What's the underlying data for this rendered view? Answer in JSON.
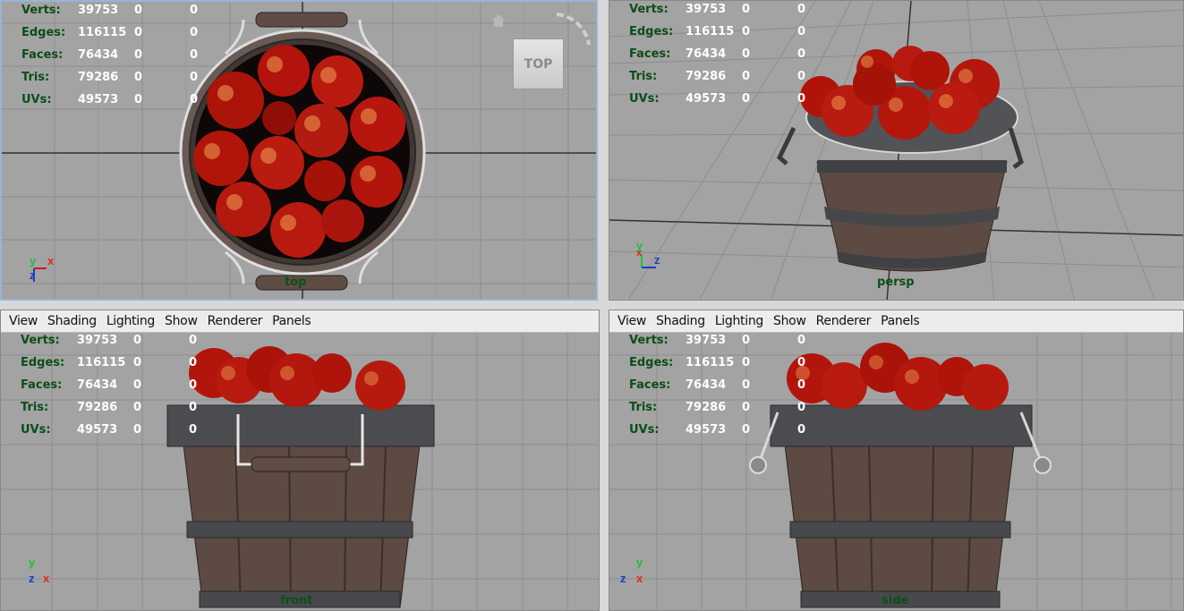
{
  "hud_labels": [
    "Verts:",
    "Edges:",
    "Faces:",
    "Tris:",
    "UVs:"
  ],
  "hud_values": [
    [
      "39753",
      "0",
      "0"
    ],
    [
      "116115",
      "0",
      "0"
    ],
    [
      "76434",
      "0",
      "0"
    ],
    [
      "79286",
      "0",
      "0"
    ],
    [
      "49573",
      "0",
      "0"
    ]
  ],
  "menu": [
    "View",
    "Shading",
    "Lighting",
    "Show",
    "Renderer",
    "Panels"
  ],
  "viewports": {
    "top": {
      "camera": "top",
      "viewcube": "TOP"
    },
    "persp": {
      "camera": "persp"
    },
    "front": {
      "camera": "front"
    },
    "side": {
      "camera": "side"
    }
  },
  "colors": {
    "viewport_bg": "#a3a3a3",
    "grid": "#8e8e8e",
    "hud_label": "#0b4d17",
    "active_border": "#9ab4d8",
    "apple": "#b2130c",
    "wood": "#5e4b44",
    "metal": "#4a4c4f"
  }
}
